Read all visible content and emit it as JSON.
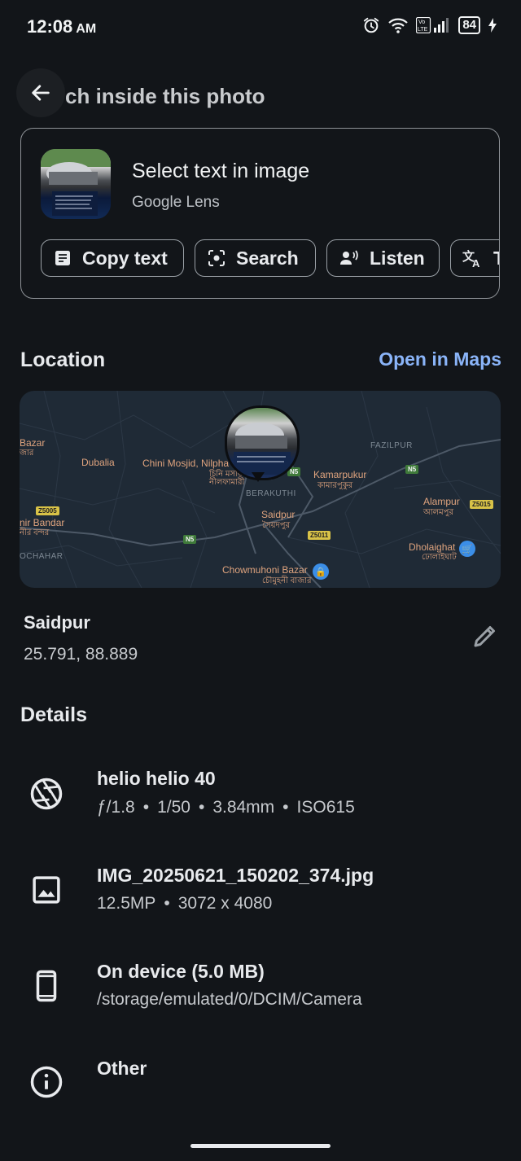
{
  "status_bar": {
    "time": "12:08",
    "ampm": "AM",
    "battery": "84"
  },
  "header": {
    "title": "ch inside this photo"
  },
  "lens_card": {
    "title": "Select text in image",
    "subtitle": "Google Lens",
    "actions": [
      {
        "label": "Copy text",
        "icon": "copy-text-icon"
      },
      {
        "label": "Search",
        "icon": "lens-search-icon"
      },
      {
        "label": "Listen",
        "icon": "listen-icon"
      },
      {
        "label": "T",
        "icon": "translate-icon"
      }
    ]
  },
  "location": {
    "heading": "Location",
    "open_maps": "Open in Maps",
    "map_labels": {
      "bazar": "Bazar",
      "bazar_bn": "জার",
      "dubalia": "Dubalia",
      "chini": "Chini Mosjid, Nilpha",
      "chini_bn1": "চিনি মসজি",
      "chini_bn2": "নীলফামারী",
      "berakuthi": "BERAKUTHI",
      "kamarpukur": "Kamarpukur",
      "kamarpukur_bn": "কামারপুকুর",
      "fazilpur": "FAZILPUR",
      "alampur": "Alampur",
      "alampur_bn": "আলমপুর",
      "saidpur": "Saidpur",
      "saidpur_bn": "সৈয়দপুর",
      "bandar": "nir Bandar",
      "bandar_bn": "নীর বন্দর",
      "dochahar": "OCHAHAR",
      "dholaighat": "Dholaighat",
      "dholaighat_bn": "ঢোলাইঘাট",
      "chowmuhoni": "Chowmuhoni Bazar",
      "chowmuhoni_bn": "চৌমুহনী বাজার",
      "road_n5": "N5",
      "road_z5005": "Z5005",
      "road_z5011": "Z5011",
      "road_z5015": "Z5015"
    },
    "place_name": "Saidpur",
    "coordinates": "25.791, 88.889"
  },
  "details": {
    "heading": "Details",
    "camera": {
      "title": "helio helio 40",
      "aperture": "ƒ/1.8",
      "shutter": "1/50",
      "focal": "3.84mm",
      "iso": "ISO615"
    },
    "file": {
      "title": "IMG_20250621_150202_374.jpg",
      "megapixels": "12.5MP",
      "resolution": "3072 x 4080"
    },
    "storage": {
      "title": "On device (5.0 MB)",
      "path": "/storage/emulated/0/DCIM/Camera"
    },
    "other": {
      "title": "Other"
    }
  },
  "colors": {
    "background": "#121519",
    "accent": "#8ab4f8",
    "map_label": "#e0a47e"
  }
}
